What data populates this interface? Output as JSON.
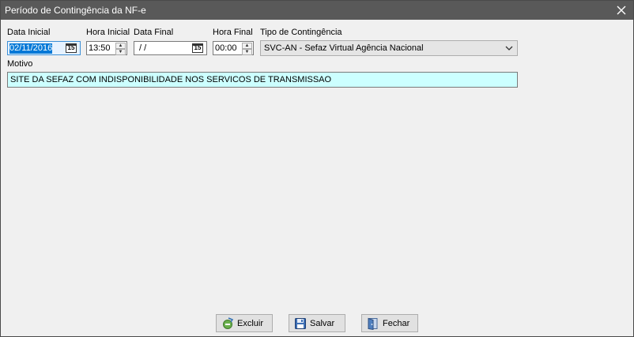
{
  "window": {
    "title": "Período de Contingência da NF-e"
  },
  "labels": {
    "data_inicial": "Data Inicial",
    "hora_inicial": "Hora Inicial",
    "data_final": "Data Final",
    "hora_final": "Hora Final",
    "tipo_contingencia": "Tipo de Contingência",
    "motivo": "Motivo"
  },
  "fields": {
    "data_inicial": "02/11/2016",
    "hora_inicial": "13:50",
    "data_final": " / /",
    "hora_final": "00:00",
    "tipo_contingencia": "SVC-AN - Sefaz Virtual Agência Nacional",
    "motivo": "SITE DA SEFAZ COM INDISPONIBILIDADE NOS SERVICOS DE TRANSMISSAO"
  },
  "calendar_icon_text": "15",
  "buttons": {
    "excluir": "Excluir",
    "salvar": "Salvar",
    "fechar": "Fechar"
  },
  "icons": {
    "close": "close-icon",
    "calendar": "calendar-icon",
    "dropdown": "chevron-down-icon",
    "excluir": "delete-icon",
    "salvar": "floppy-disk-icon",
    "fechar": "exit-door-icon"
  },
  "colors": {
    "titlebar": "#595959",
    "background": "#f0f0f0",
    "motivo_background": "#ccffff",
    "selection": "#0078d7"
  }
}
